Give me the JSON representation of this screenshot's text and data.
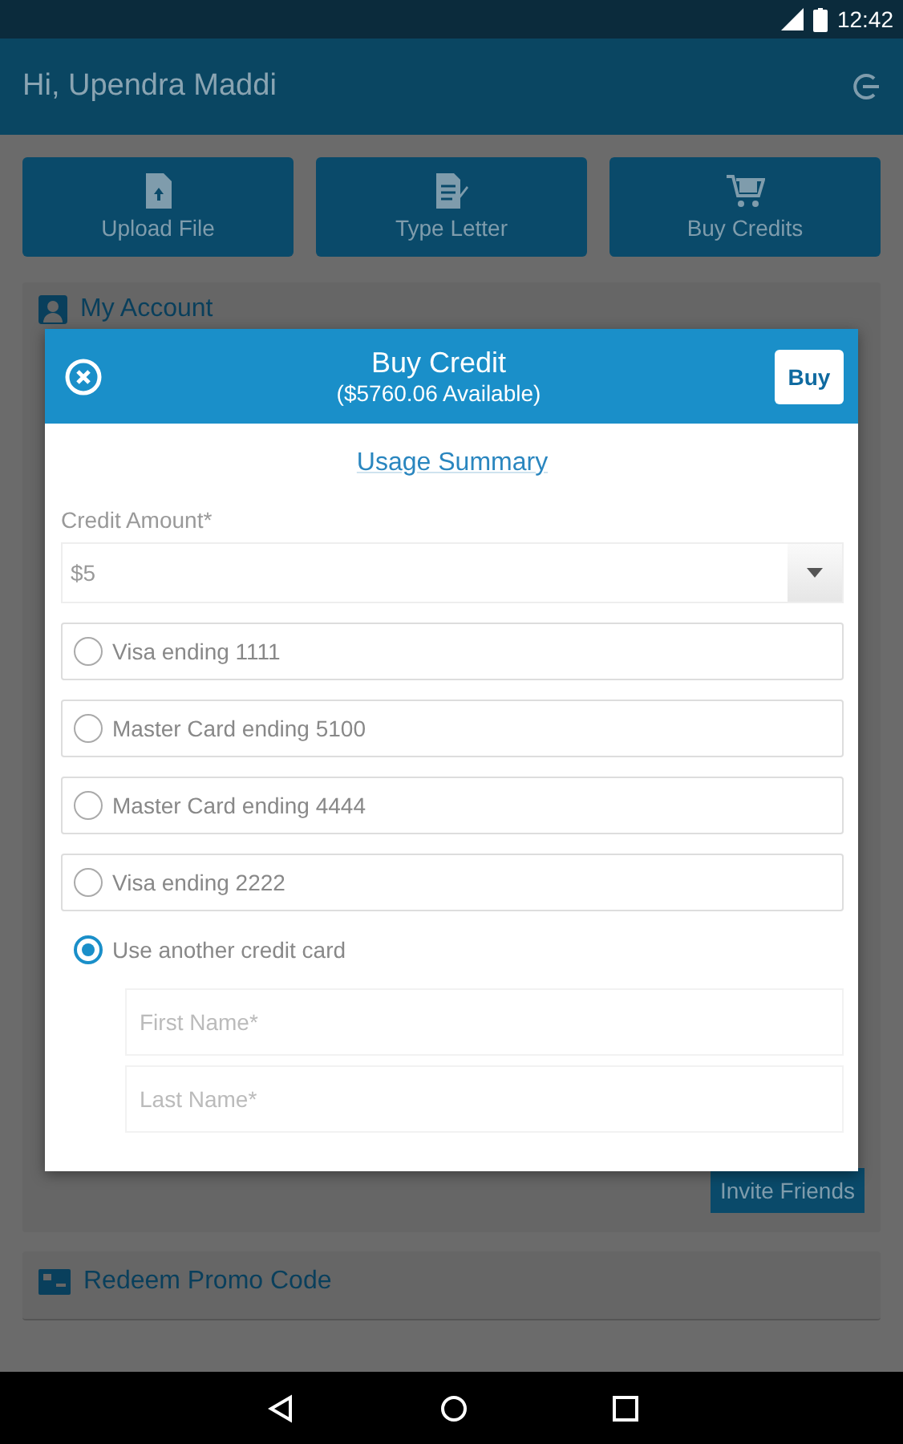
{
  "status_bar": {
    "time": "12:42"
  },
  "app_bar": {
    "greeting": "Hi, Upendra Maddi"
  },
  "actions": [
    {
      "label": "Upload File",
      "kind": "upload"
    },
    {
      "label": "Type Letter",
      "kind": "letter"
    },
    {
      "label": "Buy Credits",
      "kind": "cart"
    }
  ],
  "account_section": {
    "title": "My Account"
  },
  "invite_button": {
    "label": "Invite Friends"
  },
  "promo_section": {
    "title": "Redeem Promo Code"
  },
  "dialog": {
    "title": "Buy Credit",
    "subtitle": "($5760.06 Available)",
    "buy_button": "Buy",
    "link": "Usage Summary",
    "amount_label": "Credit Amount*",
    "amount_value": "$5",
    "payment_options": [
      {
        "label": "Visa ending 1111",
        "kind": "saved",
        "selected": false
      },
      {
        "label": "Master Card ending 5100",
        "kind": "saved",
        "selected": false
      },
      {
        "label": "Master Card ending 4444",
        "kind": "saved",
        "selected": false
      },
      {
        "label": "Visa ending 2222",
        "kind": "saved",
        "selected": false
      },
      {
        "label": "Use another credit card",
        "kind": "new",
        "selected": true
      }
    ],
    "fields": [
      {
        "placeholder": "First Name*"
      },
      {
        "placeholder": "Last Name*"
      }
    ]
  }
}
